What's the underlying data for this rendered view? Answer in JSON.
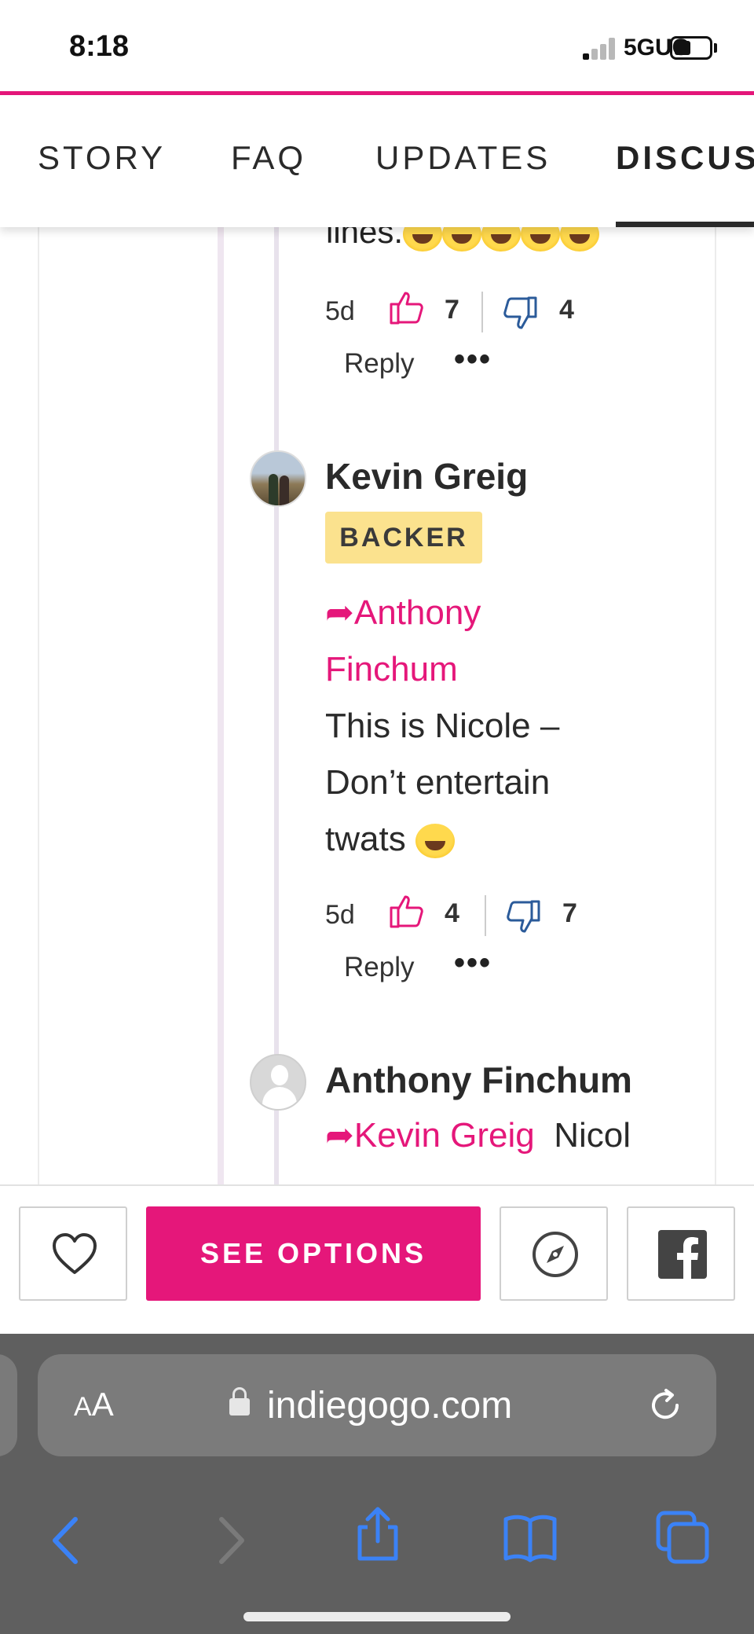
{
  "status": {
    "time": "8:18",
    "network": "5GUC"
  },
  "tabs": [
    {
      "label": "STORY"
    },
    {
      "label": "FAQ"
    },
    {
      "label": "UPDATES"
    },
    {
      "label": "DISCUS"
    }
  ],
  "comments": [
    {
      "partial_text": "lines.",
      "age": "5d",
      "likes": "7",
      "dislikes": "4",
      "reply_label": "Reply",
      "more_label": "•••"
    },
    {
      "author": "Kevin Greig",
      "badge": "BACKER",
      "mention_line1": "➦Anthony",
      "mention_line2": "Finchum",
      "text_line1": "This is Nicole –",
      "text_line2": "Don’t entertain",
      "text_line3": "twats",
      "age": "5d",
      "likes": "4",
      "dislikes": "7",
      "reply_label": "Reply",
      "more_label": "•••"
    },
    {
      "author": "Anthony Finchum",
      "mention": "➦Kevin Greig",
      "text_start": "Nicol"
    }
  ],
  "action_bar": {
    "cta_label": "SEE OPTIONS"
  },
  "browser": {
    "text_size_label_big": "A",
    "text_size_label_small": "A",
    "domain": "indiegogo.com"
  },
  "colors": {
    "accent": "#e5177a",
    "badge_bg": "#fbe28e",
    "link_blue": "#3b82f6"
  },
  "icons": [
    "heart-icon",
    "compass-icon",
    "facebook-icon",
    "back-icon",
    "forward-icon",
    "share-icon",
    "bookmarks-icon",
    "tabs-icon",
    "reload-icon",
    "lock-icon"
  ]
}
